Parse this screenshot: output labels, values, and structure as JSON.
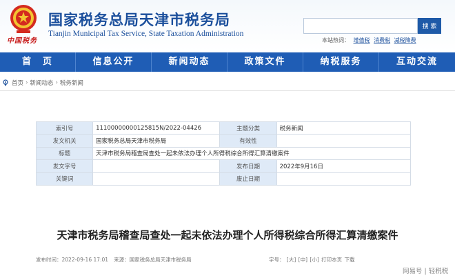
{
  "header": {
    "title": "国家税务总局天津市税务局",
    "subtitle": "Tianjin Municipal Tax Service, State Taxation Administration",
    "logo_script": "中国税务",
    "emblem_icon": "tax-emblem-icon"
  },
  "search": {
    "placeholder": "",
    "button_label": "搜 索",
    "hot_prefix": "本站热词：",
    "hot_terms": [
      "增值税",
      "消费税",
      "减税降费"
    ]
  },
  "nav": {
    "items": [
      "首　页",
      "信息公开",
      "新闻动态",
      "政策文件",
      "纳税服务",
      "互动交流"
    ]
  },
  "breadcrumb": {
    "items": [
      "首页",
      "新闻动态",
      "税务新闻"
    ],
    "separator": "›"
  },
  "info_table": {
    "index_label": "索引号",
    "index_value": "11100000000125815N/2022-04426",
    "category_label": "主题分类",
    "category_value": "税务新闻",
    "issuer_label": "发文机关",
    "issuer_value": "国家税务总局天津市税务局",
    "validity_label": "有效性",
    "validity_value": "",
    "subject_label": "标题",
    "subject_value": "天津市税务局稽查局查处一起未依法办理个人所得税综合所得汇算清缴案件",
    "doc_no_label": "发文字号",
    "doc_no_value": "",
    "date_label": "发布日期",
    "date_value": "2022年9月16日",
    "keywords_label": "关键词",
    "keywords_value": "",
    "repeal_label": "废止日期",
    "repeal_value": ""
  },
  "article": {
    "title": "天津市税务局稽查局查处一起未依法办理个人所得税综合所得汇算清缴案件",
    "publish_time": "发布时间：2022-09-16 17:01",
    "source": "来源：国家税务总局天津市税务局",
    "font_size_label": "字号：",
    "font_large": "[大]",
    "font_medium": "[中]",
    "font_small": "[小]",
    "print": "打印本页",
    "download": "下载"
  },
  "watermark": "网易号 | 轻税税",
  "colors": {
    "brand_blue": "#1b4f9c",
    "nav_blue": "#1f5db5",
    "label_bg": "#dfeaf7"
  }
}
